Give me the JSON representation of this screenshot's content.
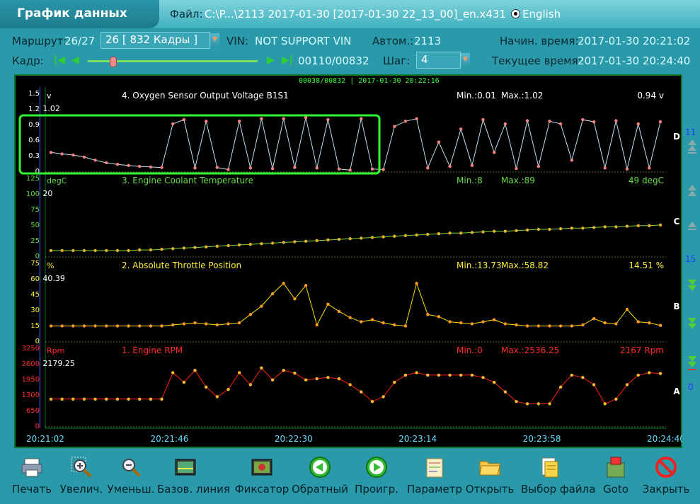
{
  "header": {
    "title": "График данных",
    "file_label": "Файл:",
    "file_value": "C:\\P...\\2113 2017-01-30 [2017-01-30 22_13_00]_en.x431",
    "language": "English"
  },
  "info": {
    "route_label": "Маршрут:",
    "route_value": "26/27",
    "route_select": "26  [   832 Кадры ]",
    "vin_label": "VIN:",
    "vin_value": "NOT SUPPORT VIN",
    "auto_label": "Автом.:",
    "auto_value": "2113",
    "start_label": "Начин. время:",
    "start_value": "2017-01-30 20:21:02",
    "frame_label": "Кадр:",
    "frame_value": "00110/00832",
    "step_label": "Шаг:",
    "step_value": "4",
    "current_label": "Текущее время:",
    "current_value": "2017-01-30 20:24:40"
  },
  "cursor_info": "00038/00832 | 2017-01-30 20:22:16",
  "x_ticks": [
    "20:21:02",
    "20:21:46",
    "20:22:30",
    "20:23:14",
    "20:23:58",
    "20:24:40"
  ],
  "side_labels": {
    "count_top": "11",
    "count_mid": "15",
    "count_bottom": "0"
  },
  "panels": [
    {
      "letter": "D",
      "unit": "v",
      "name": "4. Oxygen Sensor Output Voltage B1S1",
      "min_text": "Min.:0.01",
      "max_text": "Max.:1.02",
      "current_text": "0.94  v",
      "cursor_value": "1.02",
      "ticks": [
        "1.5",
        "1.2",
        "0.9",
        "0.6",
        "0.3",
        "0"
      ],
      "ymin": 0,
      "ymax": 1.5,
      "line_color": "#bfe3ee",
      "dot_color": "#ff8080",
      "label_color": "#ffffff"
    },
    {
      "letter": "C",
      "unit": "degC",
      "name": "3. Engine Coolant Temperature",
      "min_text": "Min.:8",
      "max_text": "Max.:89",
      "current_text": "49  degC",
      "cursor_value": "20",
      "ticks": [
        "125",
        "100",
        "75",
        "50",
        "25",
        "0"
      ],
      "ymin": 0,
      "ymax": 125,
      "line_color": "#77d833",
      "dot_color": "#e0b030",
      "label_color": "#66dd44"
    },
    {
      "letter": "B",
      "unit": "%",
      "name": "2. Absolute Throttle Position",
      "min_text": "Min.:13.73",
      "max_text": "Max.:58.82",
      "current_text": "14.51  %",
      "cursor_value": "40.39",
      "ticks": [
        "75",
        "60",
        "45",
        "30",
        "15",
        "0"
      ],
      "ymin": 0,
      "ymax": 75,
      "line_color": "#ffdd00",
      "dot_color": "#ff9a20",
      "label_color": "#ffee33"
    },
    {
      "letter": "A",
      "unit": "Rpm",
      "name": "1. Engine RPM",
      "min_text": "Min.:0",
      "max_text": "Max.:2536.25",
      "current_text": "2167  Rpm",
      "cursor_value": "2179.25",
      "ticks": [
        "3250",
        "2600",
        "1950",
        "1300",
        "650",
        "0"
      ],
      "ymin": 0,
      "ymax": 3250,
      "line_color": "#ff2010",
      "dot_color": "#ffbb33",
      "label_color": "#ff2a2a"
    }
  ],
  "chart_data": {
    "type": "line",
    "x": [
      "20:21:02",
      "20:21:06",
      "20:21:10",
      "20:21:14",
      "20:21:18",
      "20:21:22",
      "20:21:26",
      "20:21:30",
      "20:21:34",
      "20:21:38",
      "20:21:42",
      "20:21:46",
      "20:21:50",
      "20:21:54",
      "20:21:58",
      "20:22:02",
      "20:22:06",
      "20:22:10",
      "20:22:14",
      "20:22:18",
      "20:22:22",
      "20:22:26",
      "20:22:30",
      "20:22:34",
      "20:22:38",
      "20:22:42",
      "20:22:46",
      "20:22:50",
      "20:22:54",
      "20:22:58",
      "20:23:02",
      "20:23:06",
      "20:23:10",
      "20:23:14",
      "20:23:18",
      "20:23:22",
      "20:23:26",
      "20:23:30",
      "20:23:34",
      "20:23:38",
      "20:23:42",
      "20:23:46",
      "20:23:50",
      "20:23:54",
      "20:23:58",
      "20:24:02",
      "20:24:06",
      "20:24:10",
      "20:24:14",
      "20:24:18",
      "20:24:22",
      "20:24:26",
      "20:24:30",
      "20:24:34",
      "20:24:38",
      "20:24:40"
    ],
    "series": [
      {
        "name": "4. Oxygen Sensor Output Voltage B1S1",
        "values": [
          0.35,
          0.32,
          0.3,
          0.26,
          0.2,
          0.15,
          0.12,
          0.1,
          0.08,
          0.07,
          0.06,
          0.9,
          0.98,
          0.05,
          0.95,
          0.06,
          0.02,
          0.95,
          0.05,
          1.0,
          0.04,
          1.0,
          0.06,
          1.02,
          0.05,
          0.98,
          0.03,
          0.01,
          1.0,
          0.03,
          0.02,
          0.85,
          0.95,
          1.0,
          0.05,
          0.55,
          0.08,
          0.8,
          0.1,
          0.98,
          0.35,
          0.9,
          0.04,
          0.96,
          0.08,
          0.95,
          0.9,
          0.2,
          0.98,
          0.94,
          0.05,
          0.96,
          0.03,
          0.9,
          0.05,
          0.94
        ]
      },
      {
        "name": "3. Engine Coolant Temperature",
        "values": [
          8,
          8,
          8,
          8,
          8,
          8,
          8,
          8,
          9,
          9,
          10,
          11,
          12,
          13,
          14,
          15,
          16,
          17,
          18,
          19,
          20,
          21,
          22,
          23,
          24,
          25,
          26,
          27,
          28,
          29,
          30,
          31,
          32,
          33,
          34,
          35,
          36,
          36,
          37,
          38,
          39,
          39,
          40,
          41,
          42,
          42,
          43,
          44,
          44,
          45,
          46,
          46,
          47,
          48,
          48,
          49
        ]
      },
      {
        "name": "2. Absolute Throttle Position",
        "values": [
          14,
          14,
          14,
          14,
          14,
          14,
          14,
          14,
          14,
          14,
          14,
          15,
          16,
          17,
          16,
          15,
          16,
          17,
          25,
          33,
          45,
          55,
          40,
          53,
          15,
          35,
          28,
          22,
          18,
          20,
          17,
          15,
          14,
          55,
          25,
          23,
          18,
          17,
          16,
          18,
          20,
          16,
          15,
          14,
          14,
          14,
          14,
          14,
          15,
          21,
          17,
          16,
          30,
          18,
          17,
          14.5
        ]
      },
      {
        "name": "1. Engine RPM",
        "values": [
          1100,
          1100,
          1100,
          1100,
          1100,
          1100,
          1100,
          1100,
          1100,
          1100,
          1100,
          2200,
          1800,
          2300,
          1600,
          1200,
          1500,
          2200,
          1700,
          2400,
          1900,
          2300,
          2180,
          1900,
          1950,
          2000,
          1950,
          1700,
          1400,
          1000,
          1200,
          1800,
          2100,
          2200,
          2100,
          2100,
          2100,
          2100,
          2100,
          2000,
          1800,
          1400,
          1000,
          900,
          900,
          900,
          1600,
          2100,
          2000,
          1700,
          900,
          1100,
          1700,
          2100,
          2200,
          2167
        ]
      }
    ],
    "cursor_x": "20:22:16"
  },
  "toolbar": [
    {
      "label": "Печать",
      "icon": "printer-icon"
    },
    {
      "label": "Увелич.",
      "icon": "zoom-in-icon"
    },
    {
      "label": "Уменьш.",
      "icon": "zoom-out-icon"
    },
    {
      "label": "Базов. линия",
      "icon": "baseline-icon"
    },
    {
      "label": "Фиксатор",
      "icon": "lock-screen-icon"
    },
    {
      "label": "Обратный",
      "icon": "reverse-play-icon"
    },
    {
      "label": "Проигр.",
      "icon": "play-icon"
    },
    {
      "label": "Параметр",
      "icon": "parameter-icon"
    },
    {
      "label": "Открыть",
      "icon": "open-folder-icon"
    },
    {
      "label": "Выбор файла",
      "icon": "select-file-icon"
    },
    {
      "label": "Goto",
      "icon": "goto-icon"
    },
    {
      "label": "Закрыть",
      "icon": "close-icon"
    }
  ],
  "colors": {
    "accent": "#2a9aaa",
    "highlight_box": "#33ff33",
    "cursor_line": "#3a6cff"
  }
}
